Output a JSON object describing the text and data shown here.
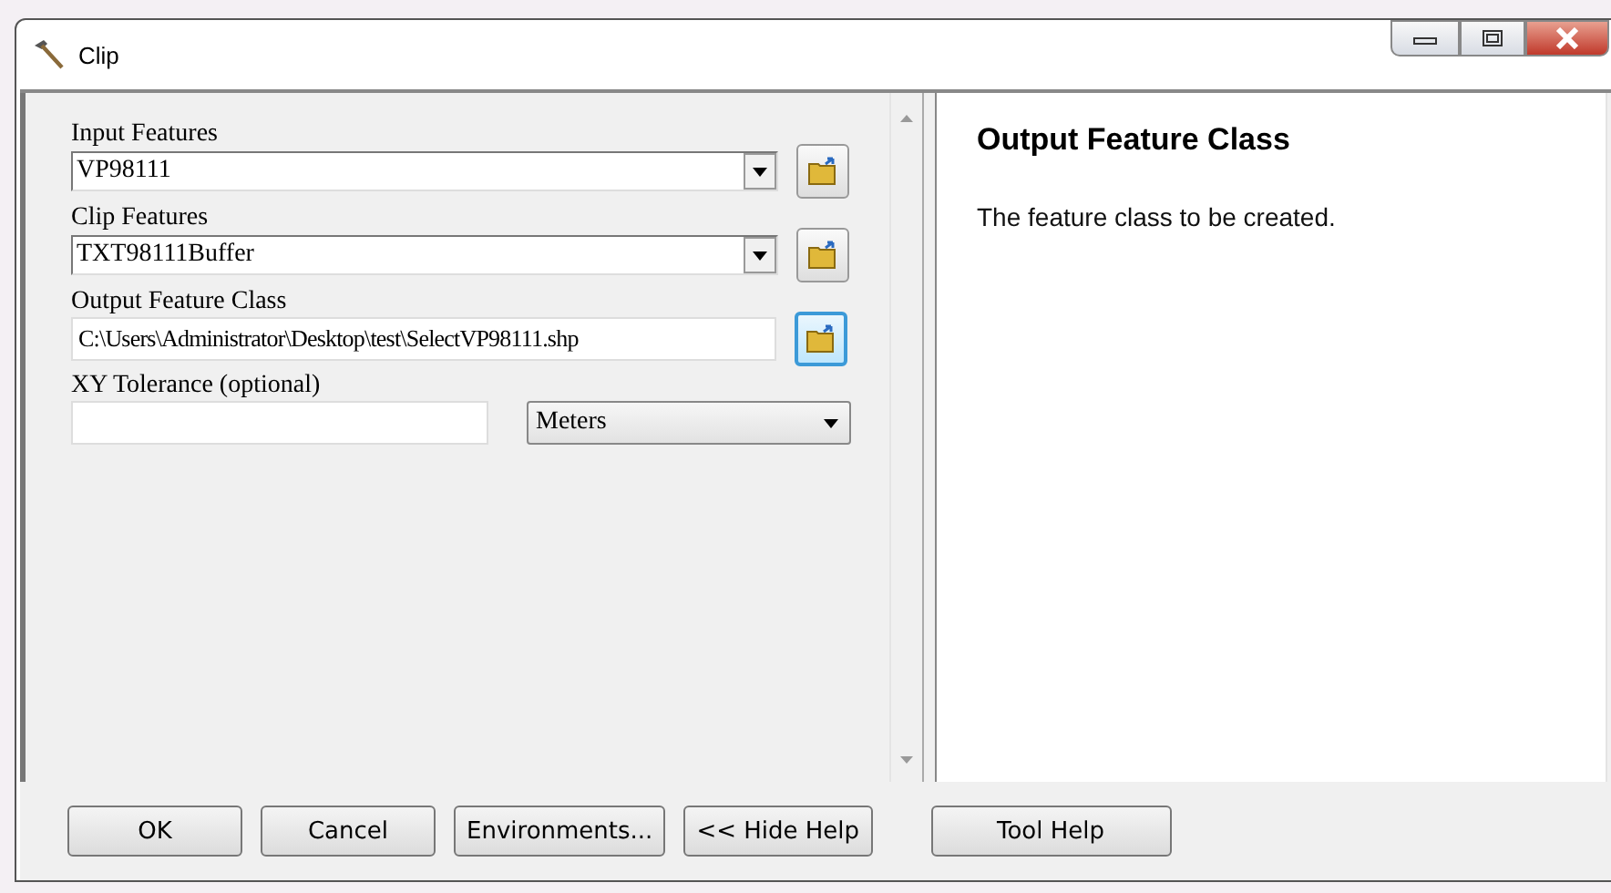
{
  "window": {
    "title": "Clip"
  },
  "parameters": [
    {
      "label": "Input Features",
      "kind": "dropdown",
      "value": "VP98111",
      "browse_focused": false
    },
    {
      "label": "Clip Features",
      "kind": "dropdown",
      "value": "TXT98111Buffer",
      "browse_focused": false
    },
    {
      "label": "Output Feature Class",
      "kind": "path",
      "value": "C:\\Users\\Administrator\\Desktop\\test\\SelectVP98111.shp",
      "browse_focused": true
    },
    {
      "label": "XY Tolerance (optional)",
      "kind": "linear",
      "units": "Meters"
    }
  ],
  "help": {
    "title": "Output Feature Class",
    "text": "The feature class to be created."
  },
  "buttons": [
    {
      "label": "OK",
      "kind": "left"
    },
    {
      "label": "Cancel",
      "kind": "left"
    },
    {
      "label": "Environments...",
      "kind": "left"
    },
    {
      "label": "<< Hide Help",
      "kind": "left"
    },
    {
      "label": "Tool Help",
      "kind": "right"
    }
  ]
}
